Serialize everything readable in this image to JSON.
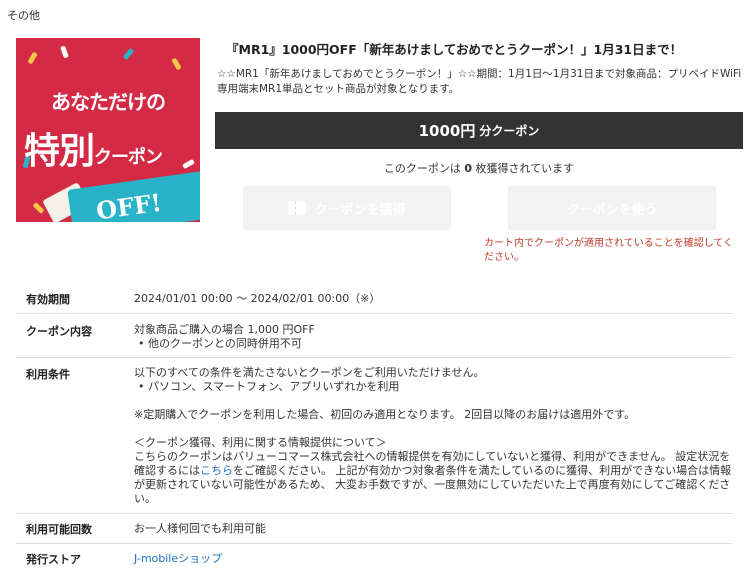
{
  "category": "その他",
  "image": {
    "line1": "あなただけの",
    "line2_big": "特別",
    "line2_small": "クーポン",
    "ticket": "OFF!"
  },
  "title": "『MR1』1000円OFF「新年あけましておめでとうクーポン！」1月31日まで！",
  "description": "☆☆MR1「新年あけましておめでとうクーポン！」☆☆期間：1月1日〜1月31日まで対象商品：プリペイドWiFi専用端末MR1単品とセット商品が対象となります。",
  "amount": {
    "big": "1000円",
    "small": "分クーポン"
  },
  "acquired": {
    "prefix": "このクーポンは",
    "count": "0",
    "suffix": "枚獲得されています"
  },
  "buttons": {
    "get": "クーポンを獲得",
    "use": "クーポンを使う"
  },
  "warning": "カート内でクーポンが適用されていることを確認してください。",
  "details": {
    "period_label": "有効期間",
    "period_value": "2024/01/01 00:00 ～ 2024/02/01 00:00（※）",
    "content_label": "クーポン内容",
    "content_value": "対象商品ご購入の場合 1,000 円OFF",
    "content_bullet": "他のクーポンとの同時併用不可",
    "terms_label": "利用条件",
    "terms_intro": "以下のすべての条件を満たさないとクーポンをご利用いただけません。",
    "terms_bullet": "パソコン、スマートフォン、アプリいずれかを利用",
    "terms_note": "※定期購入でクーポンを利用した場合、初回のみ適用となります。 2回目以降のお届けは適用外です。",
    "terms_info_head": "＜クーポン獲得、利用に関する情報提供について＞",
    "terms_info_a": "こちらのクーポンはバリューコマース株式会社への情報提供を有効にしていないと獲得、利用ができません。 設定状況を確認するには",
    "terms_info_link": "こちら",
    "terms_info_b": "をご確認ください。 上記が有効かつ対象者条件を満たしているのに獲得、利用ができない場合は情報が更新されていない可能性があるため、 大変お手数ですが、一度無効にしていただいた上で再度有効にしてご確認ください。",
    "count_label": "利用可能回数",
    "count_value": "お一人様何回でも利用可能",
    "store_label": "発行ストア",
    "store_value": "J-mobileショップ"
  },
  "colors": {
    "image_bg": "#d42a45",
    "ticket": "#28b3c8",
    "bar": "#333333",
    "warning": "#c0392b",
    "link": "#1a6fc4"
  }
}
